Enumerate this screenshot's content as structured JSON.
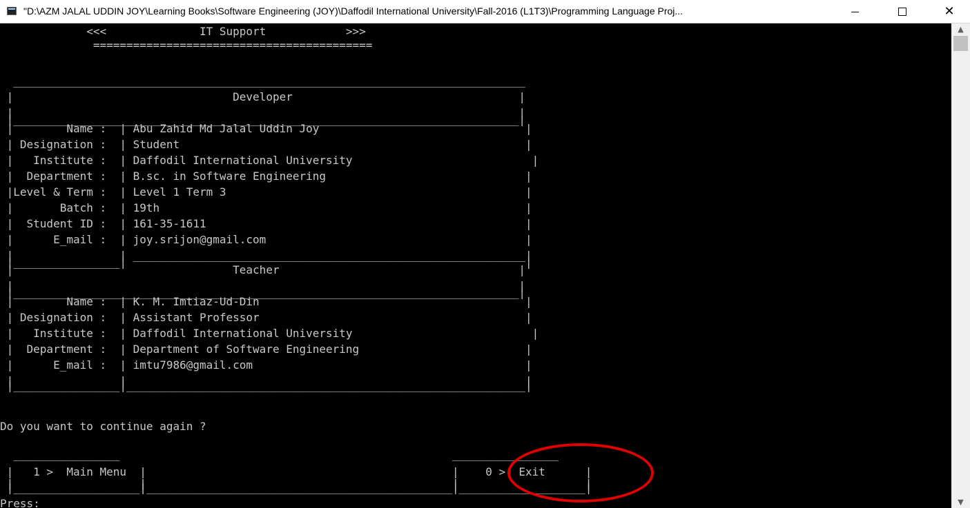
{
  "window": {
    "title": "\"D:\\AZM JALAL UDDIN JOY\\Learning Books\\Software Engineering (JOY)\\Daffodil International University\\Fall-2016 (L1T3)\\Programming Language Proj...",
    "icon": "console-app-icon",
    "controls": {
      "minimize": "minimize-icon",
      "maximize": "maximize-icon",
      "close": "close-icon",
      "close_glyph": "✕"
    }
  },
  "console": {
    "header_line": "             <<<              IT Support            >>>",
    "header_rule": "              ==========================================",
    "table_top": "  _____________________________________________________________________________",
    "section_dev_title": " |                                 Developer                                  |",
    "blank_row_1": " |                                                                            |",
    "divider_1": " |____________________________________________________________________________|",
    "developer_rows": [
      " |        Name :  | Abu Zahid Md Jalal Uddin Joy                               |",
      " | Designation :  | Student                                                    |",
      " |   Institute :  | Daffodil International University                           |",
      " |  Department :  | B.sc. in Software Engineering                              |",
      " |Level & Term :  | Level 1 Term 3                                             |",
      " |       Batch :  | 19th                                                       |",
      " |  Student ID :  | 161-35-1611                                                |",
      " |      E_mail :  | joy.srijon@gmail.com                                       |"
    ],
    "blank_row_2": " |                | ___________________________________________________________|",
    "dev_footer": " |________________|                                                            |",
    "section_teacher_title": " |                                 Teacher                                    |",
    "blank_row_3": " |                                                                            |",
    "divider_2": " |____________________________________________________________________________|",
    "teacher_rows": [
      " |        Name :  | K. M. Imtiaz-Ud-Din                                        |",
      " | Designation :  | Assistant Professor                                        |",
      " |   Institute :  | Daffodil International University                           |",
      " |  Department :  | Department of Software Engineering                         |",
      " |      E_mail :  | imtu7986@gmail.com                                         |"
    ],
    "blank_row_4": " |                |                                                            |",
    "table_bottom": " |________________|____________________________________________________________|",
    "prompt": "Do you want to continue again ?",
    "menu_top": "  ________________                                                  ________________",
    "menu_row": " |   1 >  Main Menu  |                                              |    0 >  Exit      |",
    "menu_blank": " |                   |                                              |                   |",
    "menu_bottom": " |___________________|______________________________________________|___________________|",
    "press": "Press:"
  },
  "menu_options": [
    {
      "key": "1",
      "label": "Main Menu"
    },
    {
      "key": "0",
      "label": "Exit"
    }
  ],
  "scrollbar": {
    "up": "▲",
    "down": "▼"
  },
  "colors": {
    "console_bg": "#000000",
    "console_text": "#c8c8c8",
    "annotation": "#e00000"
  }
}
